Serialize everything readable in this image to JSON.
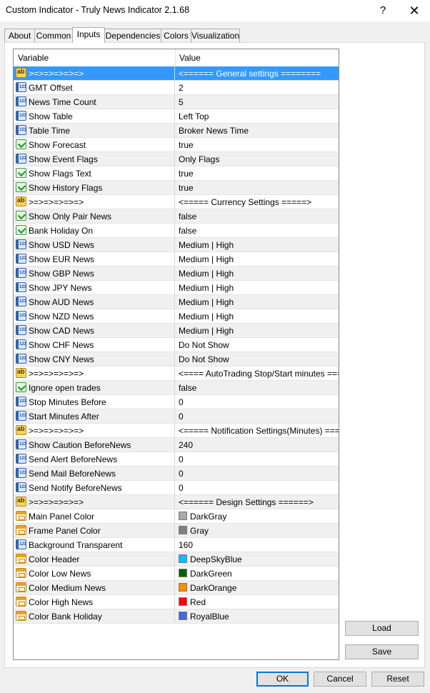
{
  "window": {
    "title": "Custom Indicator - Truly News Indicator 2.1.68",
    "help_label": "?",
    "close_label": "✕"
  },
  "tabs": [
    {
      "label": "About",
      "active": false
    },
    {
      "label": "Common",
      "active": false
    },
    {
      "label": "Inputs",
      "active": true
    },
    {
      "label": "Dependencies",
      "active": false
    },
    {
      "label": "Colors",
      "active": false
    },
    {
      "label": "Visualization",
      "active": false
    }
  ],
  "table": {
    "headers": {
      "variable": "Variable",
      "value": "Value"
    },
    "rows": [
      {
        "type": "string",
        "name": ">=>=>=>=>=>",
        "value": "<====== General settings ========",
        "selected": true
      },
      {
        "type": "number",
        "name": "GMT Offset",
        "value": "2"
      },
      {
        "type": "number",
        "name": "News Time Count",
        "value": "5"
      },
      {
        "type": "number",
        "name": "Show Table",
        "value": "Left Top"
      },
      {
        "type": "number",
        "name": "Table Time",
        "value": "Broker News Time"
      },
      {
        "type": "bool",
        "name": "Show Forecast",
        "value": "true"
      },
      {
        "type": "number",
        "name": "Show Event Flags",
        "value": "Only Flags"
      },
      {
        "type": "bool",
        "name": "Show Flags Text",
        "value": "true"
      },
      {
        "type": "bool",
        "name": "Show History Flags",
        "value": "true"
      },
      {
        "type": "string",
        "name": ">=>=>=>=>=>",
        "value": "<===== Currency Settings =====>"
      },
      {
        "type": "bool",
        "name": "Show Only Pair News",
        "value": "false"
      },
      {
        "type": "bool",
        "name": "Bank Holiday On",
        "value": "false"
      },
      {
        "type": "number",
        "name": "Show USD News",
        "value": "Medium | High"
      },
      {
        "type": "number",
        "name": "Show EUR News",
        "value": "Medium | High"
      },
      {
        "type": "number",
        "name": "Show GBP News",
        "value": "Medium | High"
      },
      {
        "type": "number",
        "name": "Show JPY News",
        "value": "Medium | High"
      },
      {
        "type": "number",
        "name": "Show AUD News",
        "value": "Medium | High"
      },
      {
        "type": "number",
        "name": "Show NZD News",
        "value": "Medium | High"
      },
      {
        "type": "number",
        "name": "Show CAD News",
        "value": "Medium | High"
      },
      {
        "type": "number",
        "name": "Show CHF News",
        "value": "Do Not Show"
      },
      {
        "type": "number",
        "name": "Show CNY News",
        "value": "Do Not Show"
      },
      {
        "type": "string",
        "name": ">=>=>=>=>=>",
        "value": "<==== AutoTrading Stop/Start minutes ====>"
      },
      {
        "type": "bool",
        "name": "Ignore open trades",
        "value": "false"
      },
      {
        "type": "number",
        "name": "Stop Minutes Before",
        "value": "0"
      },
      {
        "type": "number",
        "name": "Start Minutes After",
        "value": "0"
      },
      {
        "type": "string",
        "name": ">=>=>=>=>=>",
        "value": "<===== Notification Settings(Minutes) =====>"
      },
      {
        "type": "number",
        "name": "Show Caution BeforeNews",
        "value": "240"
      },
      {
        "type": "number",
        "name": "Send Alert BeforeNews",
        "value": "0"
      },
      {
        "type": "number",
        "name": "Send Mail BeforeNews",
        "value": "0"
      },
      {
        "type": "number",
        "name": "Send Notify BeforeNews",
        "value": "0"
      },
      {
        "type": "string",
        "name": ">=>=>=>=>=>",
        "value": "<====== Design Settings ======>"
      },
      {
        "type": "color",
        "name": "Main Panel Color",
        "value": "DarkGray",
        "swatch": "#a9a9a9"
      },
      {
        "type": "color",
        "name": "Frame Panel Color",
        "value": "Gray",
        "swatch": "#808080"
      },
      {
        "type": "number",
        "name": "Background Transparent",
        "value": "160"
      },
      {
        "type": "color",
        "name": "Color Header",
        "value": "DeepSkyBlue",
        "swatch": "#00bfff"
      },
      {
        "type": "color",
        "name": "Color Low News",
        "value": "DarkGreen",
        "swatch": "#006400"
      },
      {
        "type": "color",
        "name": "Color Medium News",
        "value": "DarkOrange",
        "swatch": "#ff8c00"
      },
      {
        "type": "color",
        "name": "Color High News",
        "value": "Red",
        "swatch": "#ff0000"
      },
      {
        "type": "color",
        "name": "Color Bank Holiday",
        "value": "RoyalBlue",
        "swatch": "#4169e1"
      }
    ]
  },
  "buttons": {
    "load": "Load",
    "save": "Save",
    "ok": "OK",
    "cancel": "Cancel",
    "reset": "Reset"
  },
  "colors": {
    "selection": "#3399ff",
    "default_button_border": "#0078d7"
  }
}
